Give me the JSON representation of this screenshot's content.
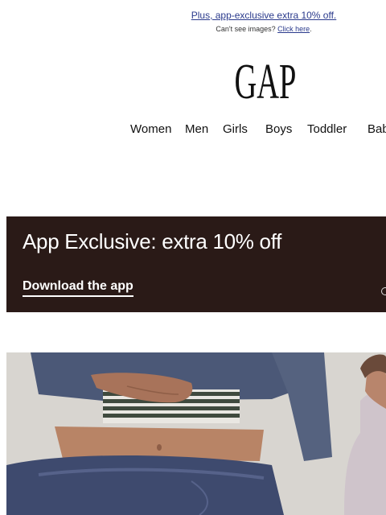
{
  "preheader": {
    "promo_text": "Plus, app-exclusive extra 10% off.",
    "cant_see_prefix": "Can't see images?",
    "click_here": "Click here",
    "period": "."
  },
  "brand": {
    "logo_text": "GAP"
  },
  "nav": {
    "items": [
      "Women",
      "Men",
      "Girls",
      "Boys",
      "Toddler",
      "Bab"
    ]
  },
  "banner": {
    "headline": "App Exclusive: extra 10% off",
    "cta": "Download the app",
    "background_color": "#2a1a17"
  },
  "hero": {
    "image": "model-in-washed-navy-sweatsuit-and-striped-top"
  }
}
